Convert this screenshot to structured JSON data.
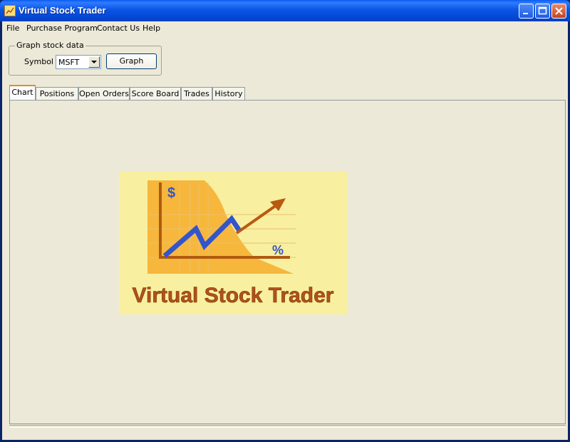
{
  "window": {
    "title": "Virtual Stock Trader"
  },
  "menu": {
    "items": [
      "File",
      "Purchase Program",
      "Contact Us",
      "Help"
    ]
  },
  "graph_group": {
    "label": "Graph stock data",
    "symbol_label": "Symbol",
    "symbol_value": "MSFT",
    "graph_button": "Graph"
  },
  "tabs": [
    "Chart",
    "Positions",
    "Open Orders",
    "Score Board",
    "Trades",
    "History"
  ],
  "logo": {
    "text": "Virtual Stock Trader",
    "dollar": "$",
    "percent": "%"
  }
}
